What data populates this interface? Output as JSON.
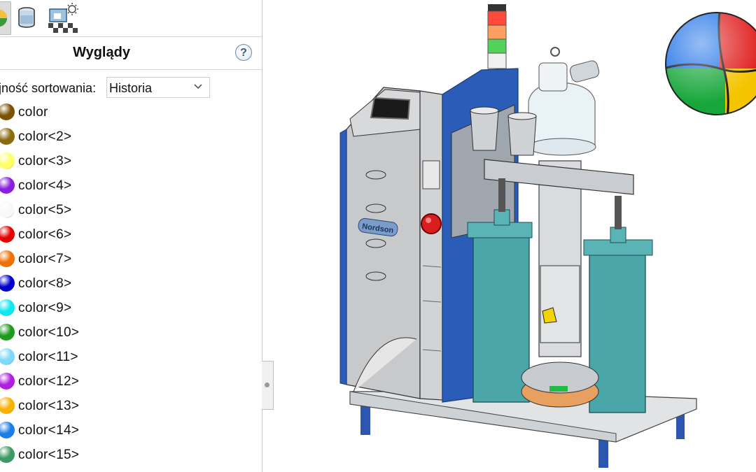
{
  "panel": {
    "title": "Wyglądy",
    "help_label": "?",
    "toolbar_icons": [
      "appearances-icon",
      "scenes-icon",
      "lighting-scene-icon"
    ],
    "sort": {
      "label": "jność sortowania:",
      "value": "Historia"
    },
    "items": [
      {
        "label": "color",
        "color": "#7a5200"
      },
      {
        "label": "color<2>",
        "color": "#8b6a10"
      },
      {
        "label": "color<3>",
        "color": "#ffff66"
      },
      {
        "label": "color<4>",
        "color": "#8a1fe0"
      },
      {
        "label": "color<5>",
        "color": "#f8f8f8"
      },
      {
        "label": "color<6>",
        "color": "#e80000"
      },
      {
        "label": "color<7>",
        "color": "#f07000"
      },
      {
        "label": "color<8>",
        "color": "#0000cc"
      },
      {
        "label": "color<9>",
        "color": "#10e8f0"
      },
      {
        "label": "color<10>",
        "color": "#1e9a1e"
      },
      {
        "label": "color<11>",
        "color": "#7fd8f8"
      },
      {
        "label": "color<12>",
        "color": "#b01ee0"
      },
      {
        "label": "color<13>",
        "color": "#f7b200"
      },
      {
        "label": "color<14>",
        "color": "#1a7ee8"
      },
      {
        "label": "color<15>",
        "color": "#3c9a64"
      }
    ]
  },
  "viewport": {
    "model_logo": "Nordson",
    "colors": {
      "frame_blue": "#2a5cb8",
      "cylinder_teal": "#4aa6a8",
      "cabinet_gray": "#c8c9cb",
      "base_plate": "#e0e2e4",
      "estop_red": "#d81e1e"
    }
  }
}
